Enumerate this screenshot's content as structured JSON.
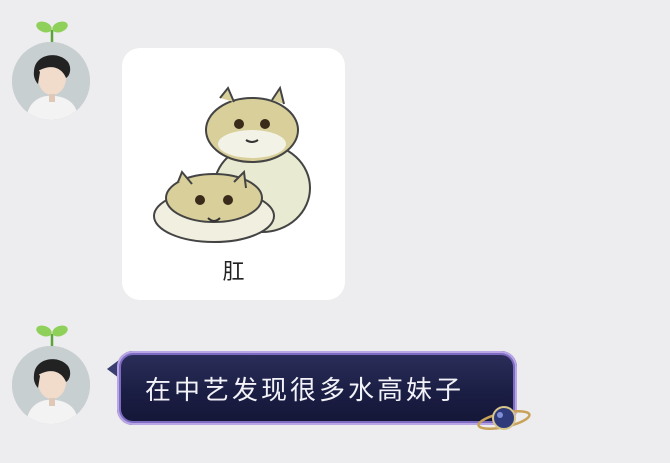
{
  "messages": [
    {
      "type": "sticker",
      "sender": "user-avatar",
      "sticker": {
        "caption": "肛",
        "icon": "hamster-sticker-icon"
      }
    },
    {
      "type": "text",
      "sender": "user-avatar",
      "text": "在中艺发现很多水高妹子",
      "bubble_style": "starry-night"
    }
  ],
  "colors": {
    "background": "#ededef",
    "bubble_dark": "#1b1e44",
    "bubble_border": "#b9a6e6",
    "bubble_text": "#f2f2f8"
  }
}
